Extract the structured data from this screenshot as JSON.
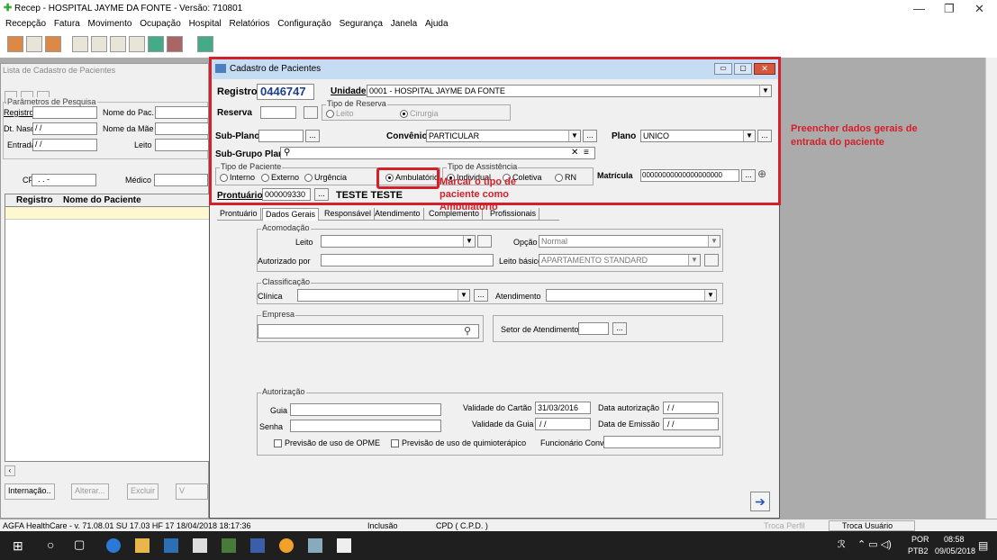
{
  "app": {
    "title": "Recep - HOSPITAL JAYME DA FONTE - Versão: 710801"
  },
  "menu": [
    "Recepção",
    "Fatura",
    "Movimento",
    "Ocupação",
    "Hospital",
    "Relatórios",
    "Configuração",
    "Segurança",
    "Janela",
    "Ajuda"
  ],
  "left_panel": {
    "title": "Lista de Cadastro de Pacientes",
    "params_legend": "Parâmetros de Pesquisa",
    "registro_label": "Registro",
    "nome_pac_label": "Nome do Pac.",
    "dt_nasc_label": "Dt. Nasc.",
    "dt_nasc_value": "/ /",
    "nome_mae_label": "Nome da Mãe",
    "entrada_label": "Entrada",
    "entrada_value": "/ /",
    "leito_label": "Leito",
    "cpf_label": "CPF",
    "cpf_value": ". . -",
    "medico_label": "Médico",
    "grid_cols": [
      "Registro",
      "Nome do Paciente"
    ],
    "btn_internacao": "Internação..",
    "btn_alterar": "Alterar...",
    "btn_excluir": "Excluir",
    "btn_v": "V"
  },
  "form": {
    "title": "Cadastro de Pacientes",
    "registro_label": "Registro",
    "registro_value": "0446747",
    "unidade_label": "Unidade",
    "unidade_value": "0001 - HOSPITAL JAYME DA FONTE",
    "reserva_label": "Reserva",
    "tipo_reserva_legend": "Tipo de Reserva",
    "tipo_reserva_leito": "Leito",
    "tipo_reserva_cirurgia": "Cirurgia",
    "subplano_label": "Sub-Plano",
    "convenio_label": "Convênio",
    "convenio_value": "PARTICULAR",
    "plano_label": "Plano",
    "plano_value": "UNICO",
    "subgrupo_label": "Sub-Grupo Plano",
    "tipo_paciente_legend": "Tipo de Paciente",
    "tipo_paciente_options": [
      "Interno",
      "Externo",
      "Urgência",
      "Ambulatório"
    ],
    "tipo_assist_legend": "Tipo de Assistência",
    "tipo_assist_options": [
      "Individual",
      "Coletiva",
      "RN"
    ],
    "matricula_label": "Matrícula",
    "matricula_value": "00000000000000000000",
    "prontuario_label": "Prontuário",
    "prontuario_value": "000009330",
    "patient_name": "TESTE TESTE",
    "tabs": [
      "Prontuário",
      "Dados Gerais",
      "Responsável",
      "Atendimento",
      "Complemento",
      "Profissionais"
    ],
    "acomodacao_legend": "Acomodação",
    "leito_label": "Leito",
    "opcao_label": "Opção",
    "opcao_value": "Normal",
    "autorizado_label": "Autorizado por",
    "leito_basico_label": "Leito básico",
    "leito_basico_value": "APARTAMENTO STANDARD",
    "classificacao_legend": "Classificação",
    "clinica_label": "Clínica",
    "atendimento_label": "Atendimento",
    "empresa_legend": "Empresa",
    "setor_label": "Setor de Atendimento",
    "autorizacao_legend": "Autorização",
    "guia_label": "Guia",
    "senha_label": "Senha",
    "validade_cartao_label": "Validade do Cartão",
    "validade_cartao_value": "31/03/2016",
    "data_autorizacao_label": "Data autorização",
    "data_autorizacao_value": "/ /",
    "validade_guia_label": "Validade da Guia",
    "validade_guia_value": "/ /",
    "data_emissao_label": "Data de Emissão",
    "data_emissao_value": "/ /",
    "opme_label": "Previsão de uso de OPME",
    "quimio_label": "Previsão de uso de quimioterápico",
    "funcionario_label": "Funcionário Conv."
  },
  "annotations": {
    "right": "Preencher dados gerais de entrada do paciente",
    "center": "Marcar o tipo de paciente como Ambulatório"
  },
  "status": {
    "version": "AGFA HealthCare - v. 71.08.01 SU 17.03 HF 17  18/04/2018 18:17:36",
    "mode": "Inclusão",
    "cpd": "CPD ( C.P.D. )",
    "troca_perfil": "Troca Perfil",
    "troca_usuario": "Troca Usuário"
  },
  "taskbar": {
    "lang": "POR",
    "layout": "PTB2",
    "time": "08:58",
    "date": "09/05/2018"
  },
  "colors": {
    "annotation_red": "#d3202a",
    "title_blue": "#c6dcf3"
  }
}
